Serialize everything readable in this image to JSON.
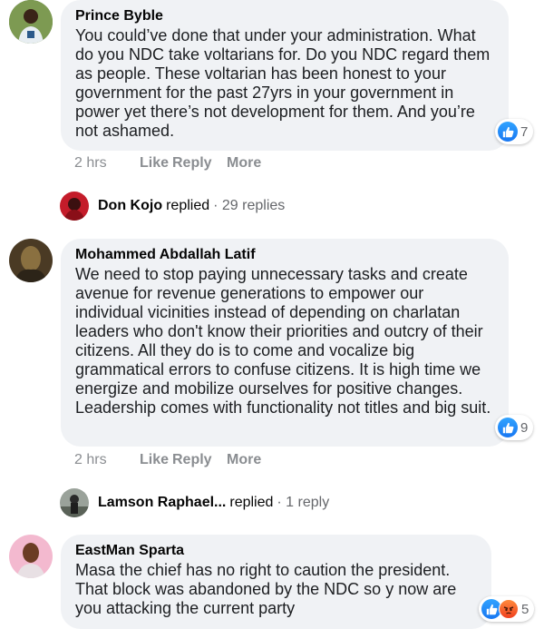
{
  "comments": [
    {
      "author": "Prince Byble",
      "text": "You could’ve done that under your administration. What do you NDC take voltarians for. Do you NDC regard them as people. These voltarian has been honest to your government for the past 27yrs in your government in power yet there’s not development for them. And you’re not ashamed.",
      "time": "2 hrs",
      "like": "Like",
      "reply": "Reply",
      "more": "More",
      "reaction_count": "7",
      "reactions": [
        "like"
      ]
    },
    {
      "author": "Mohammed Abdallah Latif",
      "text": "We need to stop paying unnecessary tasks and create avenue for revenue generations to empower our individual vicinities instead of depending on charlatan leaders who don't know their priorities and outcry of their citizens. All they do is to come and vocalize big grammatical errors to confuse citizens. It is high time we energize and mobilize ourselves for positive changes. Leadership comes with functionality not titles and big suit.",
      "time": "2 hrs",
      "like": "Like",
      "reply": "Reply",
      "more": "More",
      "reaction_count": "9",
      "reactions": [
        "like"
      ]
    },
    {
      "author": "EastMan Sparta",
      "text": "Masa the chief has no right to caution the president. That block was abandoned by the NDC so y now are you attacking the current party",
      "reaction_count": "5",
      "reactions": [
        "like",
        "angry"
      ]
    }
  ],
  "replies": [
    {
      "name": "Don Kojo",
      "verb": "replied",
      "count": "· 29 replies"
    },
    {
      "name": "Lamson Raphael...",
      "verb": "replied",
      "count": "· 1 reply"
    }
  ]
}
